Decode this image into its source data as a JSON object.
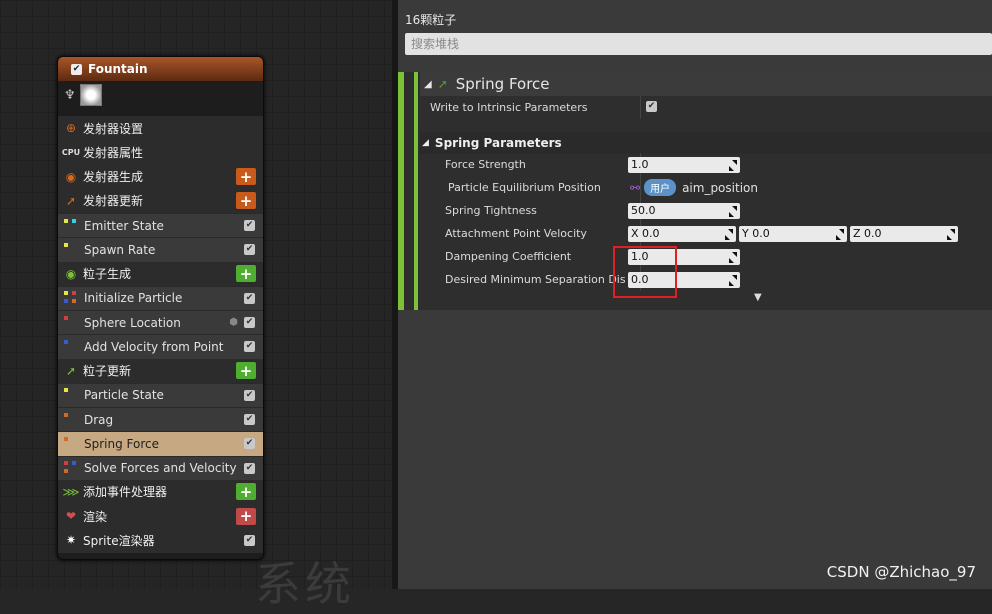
{
  "node": {
    "title": "Fountain",
    "rows": [
      {
        "type": "stage",
        "label": "发射器设置",
        "icon": "⊕",
        "icon_name": "emitter-settings-icon",
        "icon_color": "#d66a1e"
      },
      {
        "type": "stage",
        "label": "发射器属性",
        "icon": "CPU",
        "icon_name": "cpu-icon",
        "icon_color": "#dddddd"
      },
      {
        "type": "stage",
        "label": "发射器生成",
        "icon": "◉",
        "icon_name": "emitter-spawn-icon",
        "icon_color": "#d66a1e",
        "plus": "orange"
      },
      {
        "type": "stage",
        "label": "发射器更新",
        "icon": "➚",
        "icon_name": "emitter-update-icon",
        "icon_color": "#d66a1e",
        "plus": "orange"
      },
      {
        "type": "module",
        "label": "Emitter State",
        "dots": [
          "#e6e64a",
          "#36d0e6"
        ]
      },
      {
        "type": "module",
        "label": "Spawn Rate",
        "dots": [
          "#e6e64a"
        ]
      },
      {
        "type": "stage",
        "label": "粒子生成",
        "icon": "◉",
        "icon_name": "particle-spawn-icon",
        "icon_color": "#7cc236",
        "plus": "green"
      },
      {
        "type": "module",
        "label": "Initialize Particle",
        "dots": [
          "#e6e64a",
          "#d04040",
          "#3a5ad0",
          "#d06a2a"
        ]
      },
      {
        "type": "module",
        "label": "Sphere Location",
        "dots": [
          "#d04040"
        ],
        "cube": true
      },
      {
        "type": "module",
        "label": "Add Velocity from Point",
        "dots": [
          "#3a5ad0"
        ]
      },
      {
        "type": "stage",
        "label": "粒子更新",
        "icon": "➚",
        "icon_name": "particle-update-icon",
        "icon_color": "#7cc236",
        "plus": "green"
      },
      {
        "type": "module",
        "label": "Particle State",
        "dots": [
          "#e6e64a"
        ]
      },
      {
        "type": "module",
        "label": "Drag",
        "dots": [
          "#d06a2a"
        ]
      },
      {
        "type": "module",
        "label": "Spring Force",
        "dots": [
          "#d06a2a"
        ],
        "selected": true
      },
      {
        "type": "module",
        "label": "Solve Forces and Velocity",
        "dots": [
          "#d04040",
          "#3a5ad0",
          "#d06a2a"
        ]
      },
      {
        "type": "stage",
        "label": "添加事件处理器",
        "icon": "⋙",
        "icon_name": "event-handler-icon",
        "icon_color": "#7cc236",
        "plus": "green"
      },
      {
        "type": "stage",
        "label": "渲染",
        "icon": "❤",
        "icon_name": "render-icon",
        "icon_color": "#d05050",
        "plus": "red"
      },
      {
        "type": "stage",
        "label": "Sprite渲染器",
        "icon": "✷",
        "icon_name": "sprite-renderer-icon",
        "icon_color": "#ffffff",
        "check": true
      }
    ]
  },
  "details": {
    "count": "16颗粒子",
    "search_placeholder": "搜索堆栈",
    "module_title": "Spring Force",
    "write_intrinsic_label": "Write to Intrinsic Parameters",
    "section_label": "Spring Parameters",
    "force_strength_label": "Force Strength",
    "force_strength_value": "1.0",
    "equilibrium_label": "Particle Equilibrium Position",
    "user_badge": "用户",
    "equilibrium_value": "aim_position",
    "spring_tightness_label": "Spring Tightness",
    "spring_tightness_value": "50.0",
    "attachment_label": "Attachment Point Velocity",
    "attach_x": "X  0.0",
    "attach_y": "Y  0.0",
    "attach_z": "Z  0.0",
    "dampening_label": "Dampening Coefficient",
    "dampening_value": "1.0",
    "min_sep_label": "Desired Minimum Separation Dista",
    "min_sep_value": "0.0"
  },
  "watermark": "CSDN @Zhichao_97",
  "background_text": "系统"
}
